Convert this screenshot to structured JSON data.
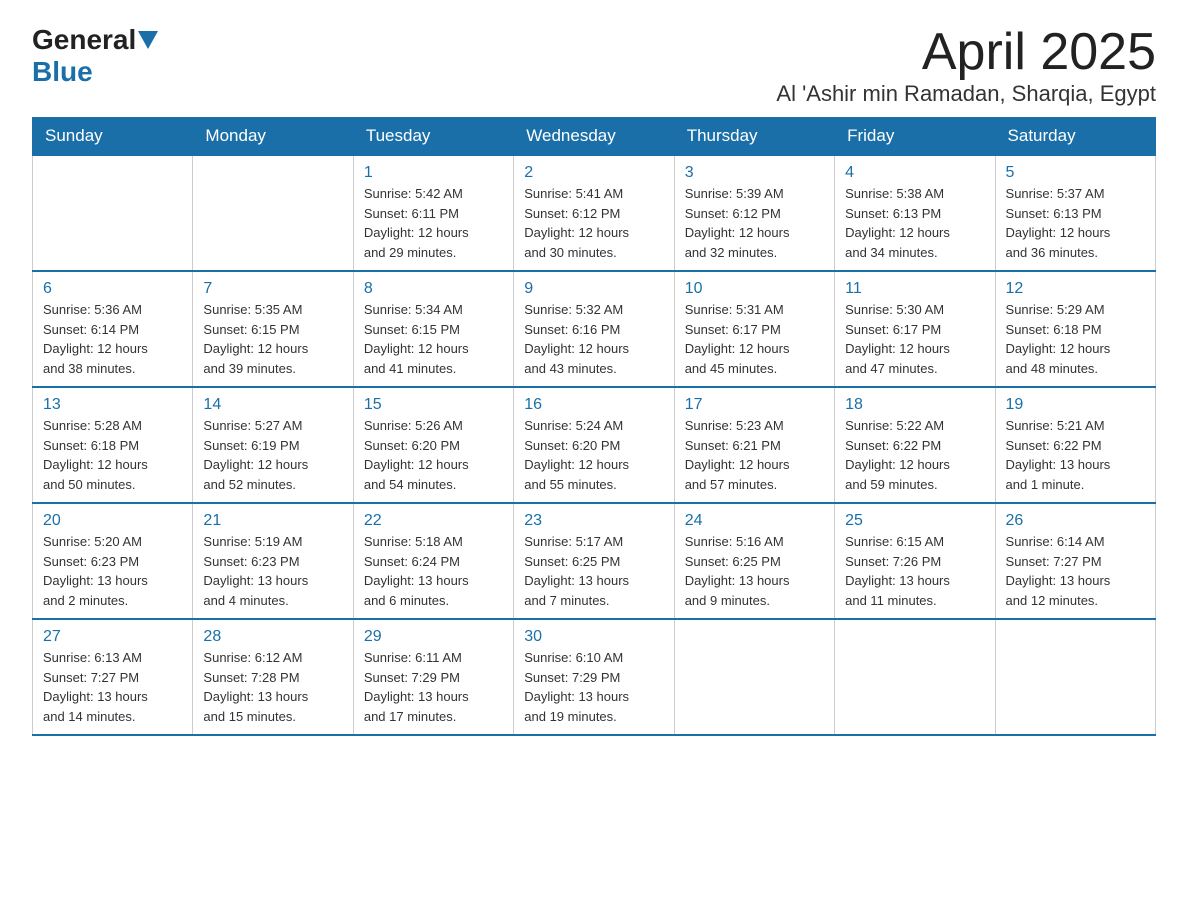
{
  "header": {
    "logo_general": "General",
    "logo_blue": "Blue",
    "title": "April 2025",
    "subtitle": "Al 'Ashir min Ramadan, Sharqia, Egypt"
  },
  "days_of_week": [
    "Sunday",
    "Monday",
    "Tuesday",
    "Wednesday",
    "Thursday",
    "Friday",
    "Saturday"
  ],
  "weeks": [
    [
      {
        "day": "",
        "info": ""
      },
      {
        "day": "",
        "info": ""
      },
      {
        "day": "1",
        "info": "Sunrise: 5:42 AM\nSunset: 6:11 PM\nDaylight: 12 hours\nand 29 minutes."
      },
      {
        "day": "2",
        "info": "Sunrise: 5:41 AM\nSunset: 6:12 PM\nDaylight: 12 hours\nand 30 minutes."
      },
      {
        "day": "3",
        "info": "Sunrise: 5:39 AM\nSunset: 6:12 PM\nDaylight: 12 hours\nand 32 minutes."
      },
      {
        "day": "4",
        "info": "Sunrise: 5:38 AM\nSunset: 6:13 PM\nDaylight: 12 hours\nand 34 minutes."
      },
      {
        "day": "5",
        "info": "Sunrise: 5:37 AM\nSunset: 6:13 PM\nDaylight: 12 hours\nand 36 minutes."
      }
    ],
    [
      {
        "day": "6",
        "info": "Sunrise: 5:36 AM\nSunset: 6:14 PM\nDaylight: 12 hours\nand 38 minutes."
      },
      {
        "day": "7",
        "info": "Sunrise: 5:35 AM\nSunset: 6:15 PM\nDaylight: 12 hours\nand 39 minutes."
      },
      {
        "day": "8",
        "info": "Sunrise: 5:34 AM\nSunset: 6:15 PM\nDaylight: 12 hours\nand 41 minutes."
      },
      {
        "day": "9",
        "info": "Sunrise: 5:32 AM\nSunset: 6:16 PM\nDaylight: 12 hours\nand 43 minutes."
      },
      {
        "day": "10",
        "info": "Sunrise: 5:31 AM\nSunset: 6:17 PM\nDaylight: 12 hours\nand 45 minutes."
      },
      {
        "day": "11",
        "info": "Sunrise: 5:30 AM\nSunset: 6:17 PM\nDaylight: 12 hours\nand 47 minutes."
      },
      {
        "day": "12",
        "info": "Sunrise: 5:29 AM\nSunset: 6:18 PM\nDaylight: 12 hours\nand 48 minutes."
      }
    ],
    [
      {
        "day": "13",
        "info": "Sunrise: 5:28 AM\nSunset: 6:18 PM\nDaylight: 12 hours\nand 50 minutes."
      },
      {
        "day": "14",
        "info": "Sunrise: 5:27 AM\nSunset: 6:19 PM\nDaylight: 12 hours\nand 52 minutes."
      },
      {
        "day": "15",
        "info": "Sunrise: 5:26 AM\nSunset: 6:20 PM\nDaylight: 12 hours\nand 54 minutes."
      },
      {
        "day": "16",
        "info": "Sunrise: 5:24 AM\nSunset: 6:20 PM\nDaylight: 12 hours\nand 55 minutes."
      },
      {
        "day": "17",
        "info": "Sunrise: 5:23 AM\nSunset: 6:21 PM\nDaylight: 12 hours\nand 57 minutes."
      },
      {
        "day": "18",
        "info": "Sunrise: 5:22 AM\nSunset: 6:22 PM\nDaylight: 12 hours\nand 59 minutes."
      },
      {
        "day": "19",
        "info": "Sunrise: 5:21 AM\nSunset: 6:22 PM\nDaylight: 13 hours\nand 1 minute."
      }
    ],
    [
      {
        "day": "20",
        "info": "Sunrise: 5:20 AM\nSunset: 6:23 PM\nDaylight: 13 hours\nand 2 minutes."
      },
      {
        "day": "21",
        "info": "Sunrise: 5:19 AM\nSunset: 6:23 PM\nDaylight: 13 hours\nand 4 minutes."
      },
      {
        "day": "22",
        "info": "Sunrise: 5:18 AM\nSunset: 6:24 PM\nDaylight: 13 hours\nand 6 minutes."
      },
      {
        "day": "23",
        "info": "Sunrise: 5:17 AM\nSunset: 6:25 PM\nDaylight: 13 hours\nand 7 minutes."
      },
      {
        "day": "24",
        "info": "Sunrise: 5:16 AM\nSunset: 6:25 PM\nDaylight: 13 hours\nand 9 minutes."
      },
      {
        "day": "25",
        "info": "Sunrise: 6:15 AM\nSunset: 7:26 PM\nDaylight: 13 hours\nand 11 minutes."
      },
      {
        "day": "26",
        "info": "Sunrise: 6:14 AM\nSunset: 7:27 PM\nDaylight: 13 hours\nand 12 minutes."
      }
    ],
    [
      {
        "day": "27",
        "info": "Sunrise: 6:13 AM\nSunset: 7:27 PM\nDaylight: 13 hours\nand 14 minutes."
      },
      {
        "day": "28",
        "info": "Sunrise: 6:12 AM\nSunset: 7:28 PM\nDaylight: 13 hours\nand 15 minutes."
      },
      {
        "day": "29",
        "info": "Sunrise: 6:11 AM\nSunset: 7:29 PM\nDaylight: 13 hours\nand 17 minutes."
      },
      {
        "day": "30",
        "info": "Sunrise: 6:10 AM\nSunset: 7:29 PM\nDaylight: 13 hours\nand 19 minutes."
      },
      {
        "day": "",
        "info": ""
      },
      {
        "day": "",
        "info": ""
      },
      {
        "day": "",
        "info": ""
      }
    ]
  ]
}
